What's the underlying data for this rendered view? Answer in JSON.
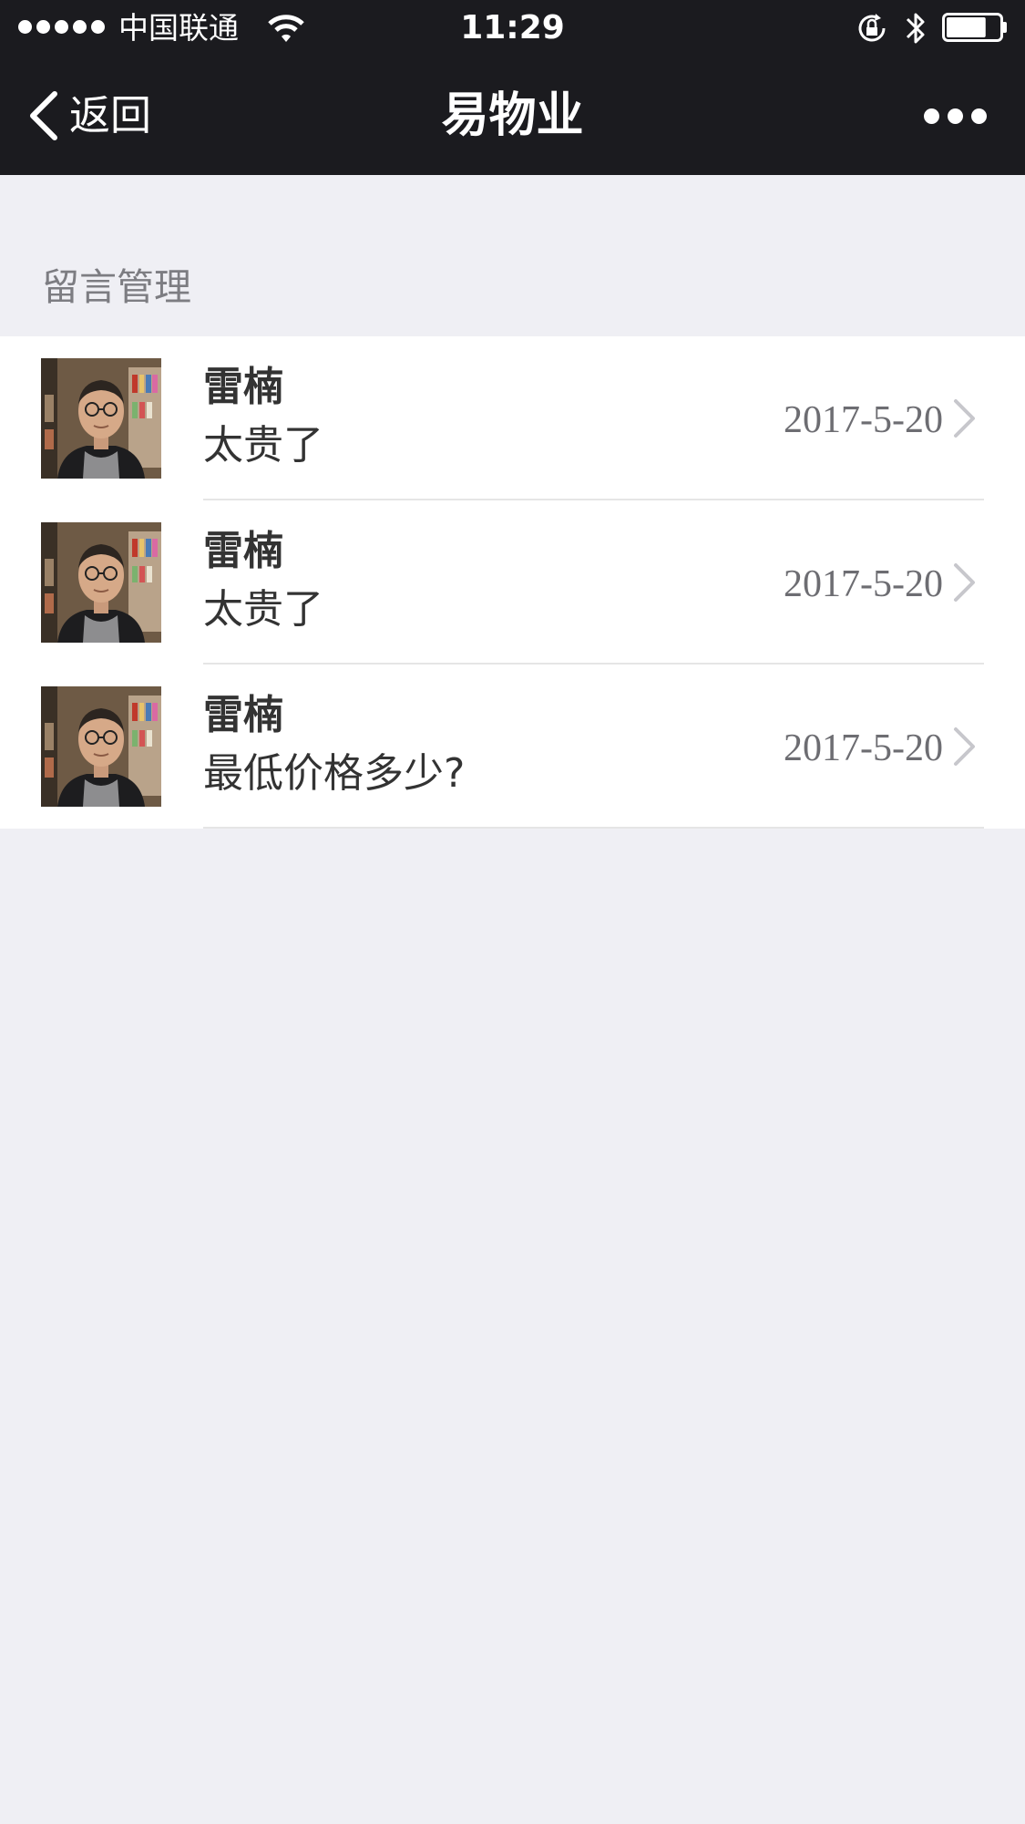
{
  "status_bar": {
    "carrier": "中国联通",
    "time": "11:29",
    "signal_icon": "signal-dots-icon",
    "wifi_icon": "wifi-icon",
    "rotation_lock_icon": "rotation-lock-icon",
    "bluetooth_icon": "bluetooth-icon",
    "battery_icon": "battery-icon",
    "battery_level": 0.75
  },
  "nav": {
    "back_label": "返回",
    "title": "易物业",
    "more_icon": "more-dots-icon",
    "background": "#1b1b1f"
  },
  "section": {
    "title": "留言管理"
  },
  "messages": [
    {
      "name": "雷楠",
      "text": "太贵了",
      "date": "2017-5-20"
    },
    {
      "name": "雷楠",
      "text": "太贵了",
      "date": "2017-5-20"
    },
    {
      "name": "雷楠",
      "text": "最低价格多少?",
      "date": "2017-5-20"
    }
  ],
  "colors": {
    "page_background": "#efeff4",
    "list_background": "#ffffff",
    "text_primary": "#333333",
    "text_secondary": "#6d6d72"
  }
}
